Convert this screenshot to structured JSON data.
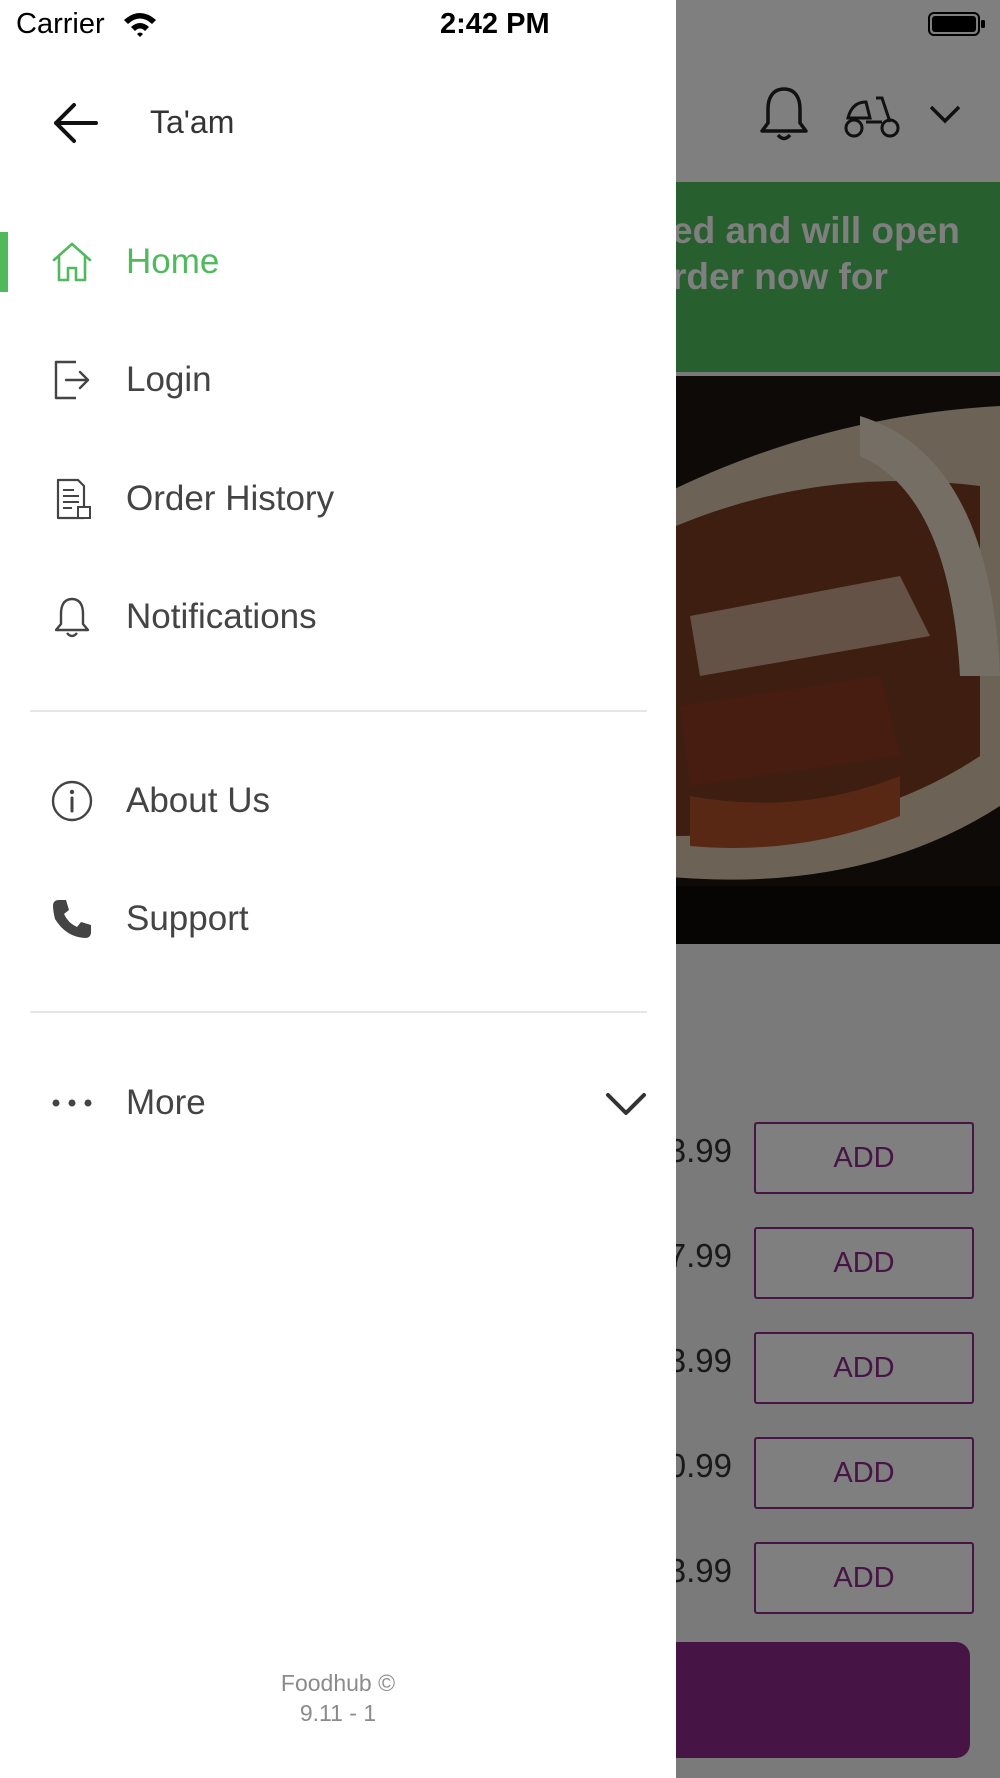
{
  "status_bar": {
    "carrier": "Carrier",
    "time": "2:42 PM"
  },
  "drawer": {
    "title": "Ta'am",
    "menu": [
      {
        "label": "Home",
        "icon": "home-icon",
        "active": true
      },
      {
        "label": "Login",
        "icon": "login-icon"
      },
      {
        "label": "Order History",
        "icon": "order-history-icon"
      },
      {
        "label": "Notifications",
        "icon": "bell-icon"
      }
    ],
    "menu2": [
      {
        "label": "About Us",
        "icon": "info-icon"
      },
      {
        "label": "Support",
        "icon": "phone-icon"
      }
    ],
    "more_label": "More",
    "footer_brand": "Foodhub ©",
    "footer_version": "9.11 - 1"
  },
  "background": {
    "banner_line1": "ed and will open",
    "banner_line2": "rder now for",
    "items": [
      {
        "price": "3.99",
        "button": "ADD"
      },
      {
        "price": "7.99",
        "button": "ADD"
      },
      {
        "price": "3.99",
        "button": "ADD"
      },
      {
        "price": "0.99",
        "button": "ADD"
      },
      {
        "price": "3.99",
        "button": "ADD"
      }
    ]
  },
  "colors": {
    "accent_green": "#4fb95c",
    "brand_purple": "#8e2a8a"
  }
}
